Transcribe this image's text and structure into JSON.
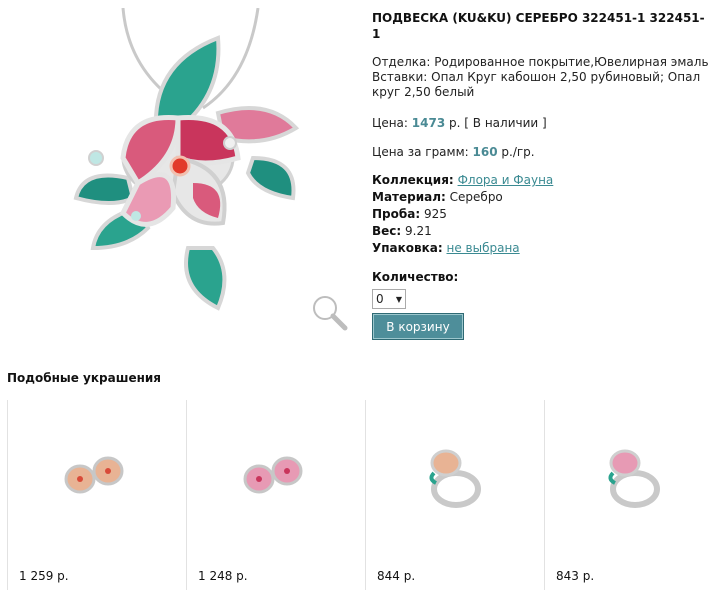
{
  "product": {
    "title": "ПОДВЕСКА (KU&KU) СЕРЕБРО 322451-1 322451-1",
    "finish": "Отделка: Родированное покрытие,Ювелирная эмаль",
    "inserts": "Вставки: Опал Круг кабошон 2,50 рубиновый; Опал круг 2,50 белый",
    "price_label": "Цена:",
    "price_value": "1473",
    "price_unit": "р.",
    "availability": "[ В наличии ]",
    "gram_label": "Цена за грамм:",
    "gram_value": "160",
    "gram_unit": "р./гр.",
    "specs": {
      "collection_label": "Коллекция:",
      "collection_value": "Флора и Фауна",
      "material_label": "Материал:",
      "material_value": "Серебро",
      "probe_label": "Проба:",
      "probe_value": "925",
      "weight_label": "Вес:",
      "weight_value": "9.21",
      "package_label": "Упаковка:",
      "package_value": "не выбрана"
    },
    "qty_label": "Количество:",
    "qty_value": "0",
    "cart_button": "В корзину"
  },
  "similar": {
    "title": "Подобные украшения",
    "items": [
      {
        "name": "earrings-peach",
        "price": "1 259 р."
      },
      {
        "name": "earrings-pink",
        "price": "1 248 р."
      },
      {
        "name": "ring-peach",
        "price": "844 р."
      },
      {
        "name": "ring-pink",
        "price": "843 р."
      }
    ]
  },
  "icons": {
    "zoom": "magnifier-icon",
    "dropdown": "chevron-down-icon"
  },
  "colors": {
    "accent": "#4a8a94",
    "button": "#4e8e9a",
    "link": "#3a8a92"
  }
}
